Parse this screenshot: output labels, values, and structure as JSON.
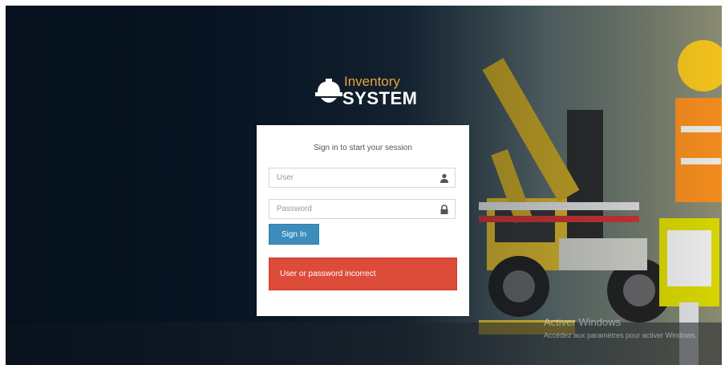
{
  "logo": {
    "line1": "Inventory",
    "line2": "SYSTEM"
  },
  "login": {
    "message": "Sign in to start your session",
    "user_placeholder": "User",
    "password_placeholder": "Password",
    "signin_label": "Sign In",
    "error_text": "User or password incorrect"
  },
  "watermark": {
    "line1": "Activer Windows",
    "line2": "Accédez aux paramètres pour activer Windows."
  },
  "colors": {
    "primary": "#3c8dbc",
    "danger": "#dd4b39",
    "logo_accent": "#e8a43b"
  }
}
